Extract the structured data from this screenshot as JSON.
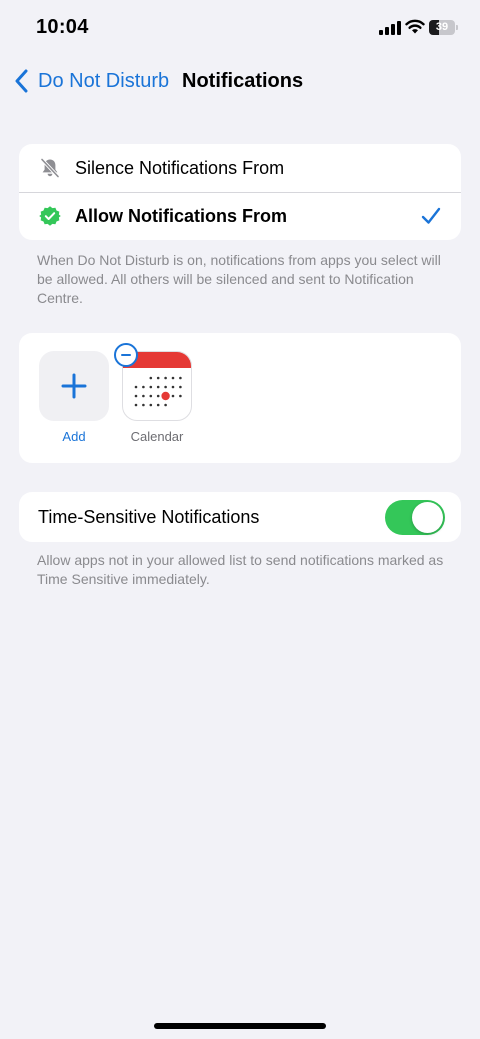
{
  "status_bar": {
    "time": "10:04",
    "battery_percent": "39",
    "signal_bars": 4,
    "wifi": "wifi-icon"
  },
  "nav": {
    "back_label": "Do Not Disturb",
    "title": "Notifications"
  },
  "mode_options": [
    {
      "label": "Silence Notifications From",
      "icon": "bell-slash-icon",
      "selected": false
    },
    {
      "label": "Allow Notifications From",
      "icon": "green-check-badge-icon",
      "selected": true
    }
  ],
  "mode_footnote": "When Do Not Disturb is on, notifications from apps you select will be allowed. All others will be silenced and sent to Notification Centre.",
  "apps": {
    "add_label": "Add",
    "items": [
      {
        "label": "Calendar",
        "icon": "calendar-app-icon"
      }
    ]
  },
  "time_sensitive": {
    "label": "Time-Sensitive Notifications",
    "enabled": true,
    "footnote": "Allow apps not in your allowed list to send notifications marked as Time Sensitive immediately."
  },
  "colors": {
    "accent": "#1a74d8",
    "toggle_on": "#34c759",
    "calendar_red": "#e53935",
    "background": "#f2f2f7"
  }
}
